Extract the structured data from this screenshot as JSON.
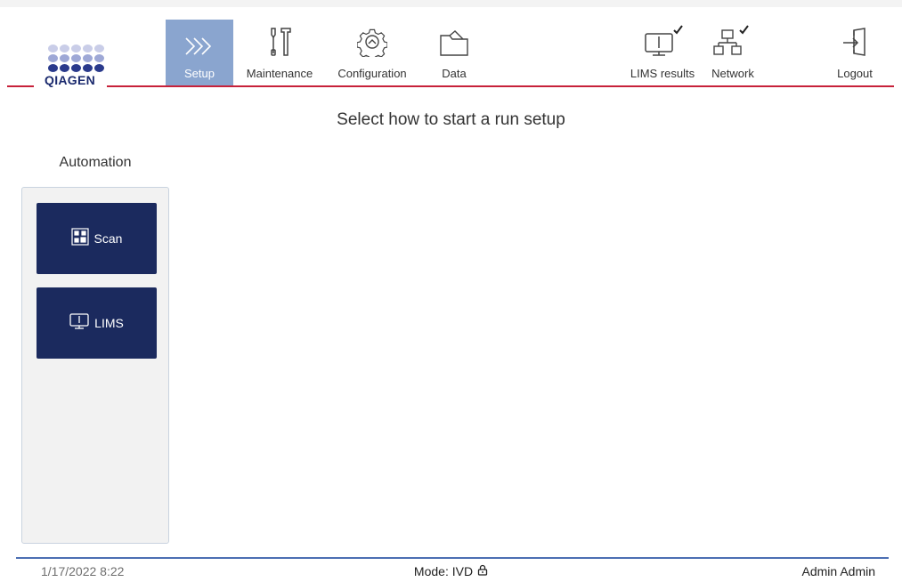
{
  "brand": {
    "name": "QIAGEN",
    "dot_colors": [
      "#c9cde8",
      "#9ea8d6",
      "#2a3a8c"
    ]
  },
  "nav": {
    "setup": "Setup",
    "maintenance": "Maintenance",
    "configuration": "Configuration",
    "data": "Data",
    "lims_results": "LIMS results",
    "network": "Network",
    "logout": "Logout",
    "active": "setup"
  },
  "main": {
    "title": "Select how to start a run setup",
    "automation_label": "Automation",
    "buttons": {
      "scan": "Scan",
      "lims": "LIMS"
    }
  },
  "footer": {
    "datetime": "1/17/2022 8:22",
    "mode": "Mode: IVD",
    "user": "Admin Admin"
  },
  "colors": {
    "accent_red": "#c7213a",
    "active_tab": "#8aa5cf",
    "button_navy": "#1b2a5e",
    "footer_line": "#4b6fb3"
  },
  "icons": {
    "setup": "chevrons-right-icon",
    "maintenance": "tools-icon",
    "configuration": "gear-icon",
    "data": "folder-icon",
    "lims_results": "monitor-check-icon",
    "network": "network-check-icon",
    "logout": "logout-icon",
    "scan": "qr-code-icon",
    "lims": "monitor-icon",
    "mode": "lock-icon"
  }
}
